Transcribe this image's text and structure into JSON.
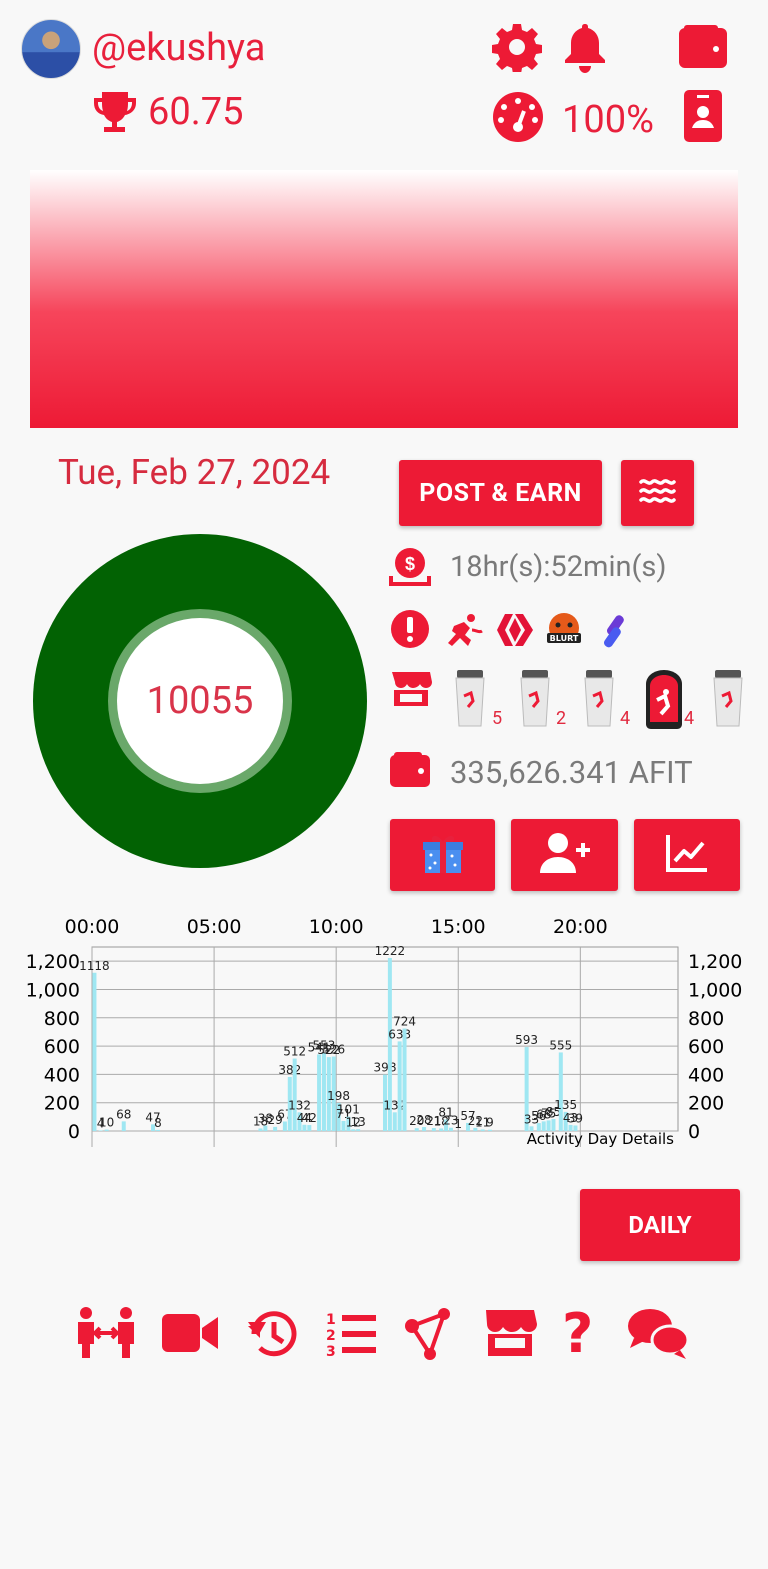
{
  "header": {
    "username": "@ekushya",
    "score": "60.75",
    "percent": "100%"
  },
  "main": {
    "date": "Tue, Feb 27, 2024",
    "post_earn_label": "POST & EARN",
    "steps": "10055",
    "timer": "18hr(s):52min(s)",
    "wallet_balance": "335,626.341 AFIT",
    "daily_label": "DAILY",
    "ring_color": "#026203"
  },
  "products": [
    {
      "count": "5"
    },
    {
      "count": "2"
    },
    {
      "count": "4"
    },
    {
      "count": "4"
    },
    {
      "count": ""
    }
  ],
  "colors": {
    "accent": "#ed1a35",
    "bar": "#9fe7f2"
  },
  "icons": {
    "header": [
      "gear-icon",
      "bell-icon",
      "wallet-icon",
      "speedometer-icon",
      "id-badge-icon"
    ],
    "status": [
      "alert-icon",
      "actifit-runner-icon",
      "hive-logo-icon",
      "blurt-logo-icon",
      "splinterlands-logo-icon"
    ],
    "actions": [
      "gift-icon",
      "add-user-icon",
      "chart-line-icon"
    ],
    "bottom": [
      "friends-icon",
      "video-icon",
      "history-icon",
      "ranking-list-icon",
      "share-icon",
      "shop-icon",
      "help-icon",
      "chat-icon"
    ]
  },
  "chart_data": {
    "type": "bar",
    "title": "",
    "caption": "Activity Day Details",
    "x_top_ticks": [
      "00:00",
      "05:00",
      "10:00",
      "15:00",
      "20:00"
    ],
    "y_ticks": [
      "1,200",
      "1,000",
      "800",
      "600",
      "400",
      "200",
      "0"
    ],
    "ylim": [
      0,
      1300
    ],
    "series_color": "#9fe7f2",
    "bars": [
      {
        "x": 0.1,
        "v": 1118
      },
      {
        "x": 0.35,
        "v": 4
      },
      {
        "x": 0.6,
        "v": 10
      },
      {
        "x": 1.3,
        "v": 68
      },
      {
        "x": 2.5,
        "v": 47
      },
      {
        "x": 2.7,
        "v": 8
      },
      {
        "x": 6.9,
        "v": 18
      },
      {
        "x": 7.1,
        "v": 38
      },
      {
        "x": 7.5,
        "v": 29
      },
      {
        "x": 7.9,
        "v": 67
      },
      {
        "x": 8.1,
        "v": 382
      },
      {
        "x": 8.3,
        "v": 512
      },
      {
        "x": 8.5,
        "v": 132
      },
      {
        "x": 8.7,
        "v": 44
      },
      {
        "x": 8.9,
        "v": 42
      },
      {
        "x": 9.3,
        "v": 541
      },
      {
        "x": 9.5,
        "v": 553
      },
      {
        "x": 9.7,
        "v": 522
      },
      {
        "x": 9.9,
        "v": 526
      },
      {
        "x": 10.1,
        "v": 198
      },
      {
        "x": 10.3,
        "v": 71
      },
      {
        "x": 10.5,
        "v": 101
      },
      {
        "x": 10.7,
        "v": 12
      },
      {
        "x": 10.9,
        "v": 13
      },
      {
        "x": 12.0,
        "v": 398
      },
      {
        "x": 12.2,
        "v": 1222
      },
      {
        "x": 12.4,
        "v": 132
      },
      {
        "x": 12.6,
        "v": 633
      },
      {
        "x": 12.8,
        "v": 724
      },
      {
        "x": 13.3,
        "v": 20
      },
      {
        "x": 13.6,
        "v": 28
      },
      {
        "x": 14.0,
        "v": 21
      },
      {
        "x": 14.3,
        "v": 18
      },
      {
        "x": 14.5,
        "v": 81
      },
      {
        "x": 14.7,
        "v": 23
      },
      {
        "x": 15.0,
        "v": 1
      },
      {
        "x": 15.4,
        "v": 57
      },
      {
        "x": 15.7,
        "v": 22
      },
      {
        "x": 16.0,
        "v": 11
      },
      {
        "x": 16.3,
        "v": 9
      },
      {
        "x": 17.8,
        "v": 593
      },
      {
        "x": 18.0,
        "v": 33
      },
      {
        "x": 18.3,
        "v": 56
      },
      {
        "x": 18.5,
        "v": 68
      },
      {
        "x": 18.7,
        "v": 75
      },
      {
        "x": 18.9,
        "v": 85
      },
      {
        "x": 19.2,
        "v": 555
      },
      {
        "x": 19.4,
        "v": 135
      },
      {
        "x": 19.6,
        "v": 43
      },
      {
        "x": 19.8,
        "v": 39
      }
    ]
  }
}
